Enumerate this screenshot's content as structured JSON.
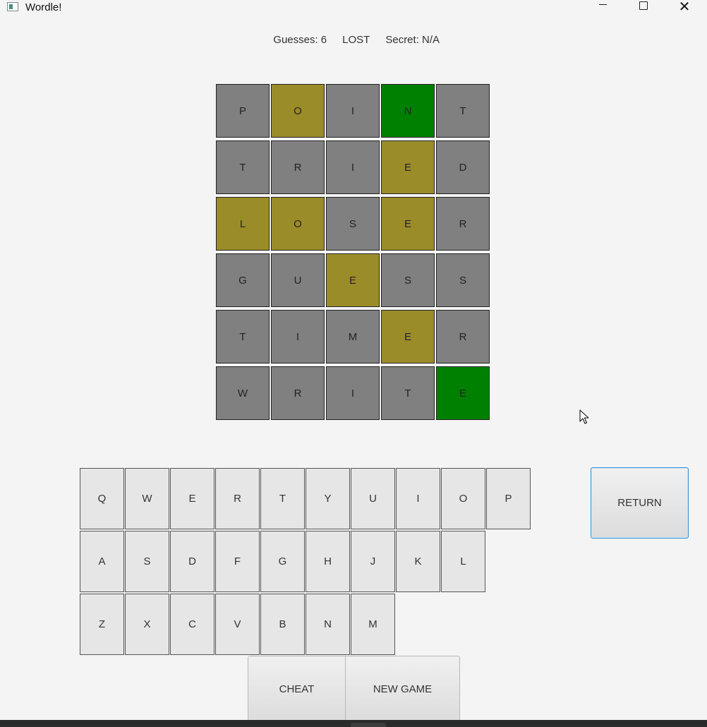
{
  "window": {
    "title": "Wordle!"
  },
  "status": {
    "guesses": "Guesses: 6",
    "result": "LOST",
    "secret": "Secret: N/A"
  },
  "colors": {
    "gray": "#808080",
    "yellow": "#9b8c2a",
    "green": "#008000",
    "key": "#e6e6e6",
    "focus": "#2f8fd8"
  },
  "board": [
    [
      {
        "letter": "P",
        "state": "gray"
      },
      {
        "letter": "O",
        "state": "yellow"
      },
      {
        "letter": "I",
        "state": "gray"
      },
      {
        "letter": "N",
        "state": "green"
      },
      {
        "letter": "T",
        "state": "gray"
      }
    ],
    [
      {
        "letter": "T",
        "state": "gray"
      },
      {
        "letter": "R",
        "state": "gray"
      },
      {
        "letter": "I",
        "state": "gray"
      },
      {
        "letter": "E",
        "state": "yellow"
      },
      {
        "letter": "D",
        "state": "gray"
      }
    ],
    [
      {
        "letter": "L",
        "state": "yellow"
      },
      {
        "letter": "O",
        "state": "yellow"
      },
      {
        "letter": "S",
        "state": "gray"
      },
      {
        "letter": "E",
        "state": "yellow"
      },
      {
        "letter": "R",
        "state": "gray"
      }
    ],
    [
      {
        "letter": "G",
        "state": "gray"
      },
      {
        "letter": "U",
        "state": "gray"
      },
      {
        "letter": "E",
        "state": "yellow"
      },
      {
        "letter": "S",
        "state": "gray"
      },
      {
        "letter": "S",
        "state": "gray"
      }
    ],
    [
      {
        "letter": "T",
        "state": "gray"
      },
      {
        "letter": "I",
        "state": "gray"
      },
      {
        "letter": "M",
        "state": "gray"
      },
      {
        "letter": "E",
        "state": "yellow"
      },
      {
        "letter": "R",
        "state": "gray"
      }
    ],
    [
      {
        "letter": "W",
        "state": "gray"
      },
      {
        "letter": "R",
        "state": "gray"
      },
      {
        "letter": "I",
        "state": "gray"
      },
      {
        "letter": "T",
        "state": "gray"
      },
      {
        "letter": "E",
        "state": "green"
      }
    ]
  ],
  "keyboard": [
    [
      "Q",
      "W",
      "E",
      "R",
      "T",
      "Y",
      "U",
      "I",
      "O",
      "P"
    ],
    [
      "A",
      "S",
      "D",
      "F",
      "G",
      "H",
      "J",
      "K",
      "L"
    ],
    [
      "Z",
      "X",
      "C",
      "V",
      "B",
      "N",
      "M"
    ]
  ],
  "buttons": {
    "return": "RETURN",
    "cheat": "CHEAT",
    "new_game": "NEW GAME"
  }
}
